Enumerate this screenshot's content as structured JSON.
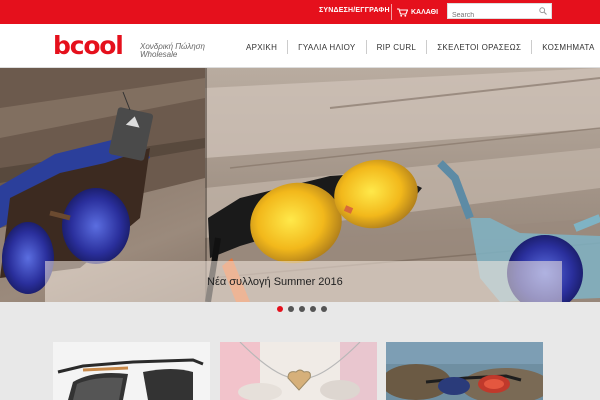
{
  "topbar": {
    "login_label": "ΣΥΝΔΕΣΗ/ΕΓΓΡΑΦΗ",
    "cart_label": "ΚΑΛΑΘΙ",
    "search_placeholder": "Search"
  },
  "brand": {
    "logo_text": "bcool",
    "tagline_line1": "Χονδρική Πώληση",
    "tagline_line2": "Wholesale",
    "accent_color": "#e5101c"
  },
  "nav": {
    "items": [
      "ΑΡΧΙΚΗ",
      "ΓΥΑΛΙΑ ΗΛΙΟΥ",
      "RIP CURL",
      "ΣΚΕΛΕΤΟΙ ΟΡΑΣΕΩΣ",
      "ΚΟΣΜΗΜΑΤΑ"
    ]
  },
  "hero": {
    "caption": "Νέα συλλογή Summer 2016",
    "slide_count": 5,
    "active_slide": 1
  },
  "products": {
    "cards": [
      {
        "icon": "sunglasses-product-image"
      },
      {
        "icon": "jewelry-product-image"
      },
      {
        "icon": "sunglasses-on-rocks-product-image"
      }
    ]
  }
}
